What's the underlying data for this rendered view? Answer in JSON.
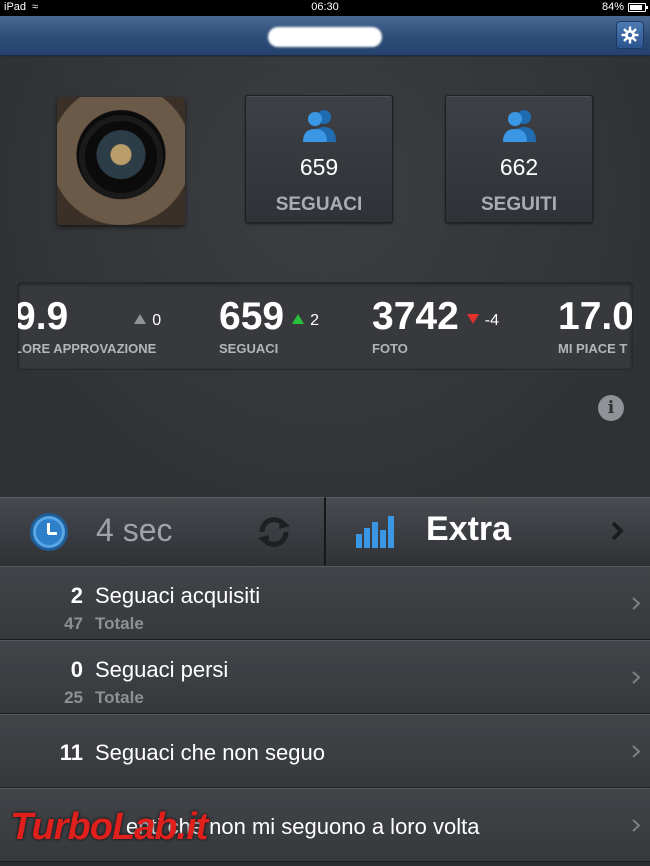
{
  "status_bar": {
    "carrier": "iPad",
    "time": "06:30",
    "battery": "84%"
  },
  "nav": {
    "title": "",
    "settings_icon": "gear-icon"
  },
  "profile": {
    "avatar": "profile-photo"
  },
  "stats": {
    "followers": {
      "value": "659",
      "label": "SEGUACI",
      "icon": "people-icon"
    },
    "following": {
      "value": "662",
      "label": "SEGUITI",
      "icon": "people-icon"
    }
  },
  "ticker": [
    {
      "value": "9.9",
      "caption": "LORE APPROVAZIONE",
      "delta": "0",
      "trend": "flat"
    },
    {
      "value": "659",
      "caption": "SEGUACI",
      "delta": "2",
      "trend": "up"
    },
    {
      "value": "3742",
      "caption": "FOTO",
      "delta": "-4",
      "trend": "down"
    },
    {
      "value": "17.0",
      "caption": "MI PIACE T",
      "delta": "",
      "trend": ""
    }
  ],
  "toolbar": {
    "refresh_interval": "4 sec",
    "extra_label": "Extra"
  },
  "list": [
    {
      "count": "2",
      "title": "Seguaci acquisiti",
      "subcount": "47",
      "sublabel": "Totale"
    },
    {
      "count": "0",
      "title": "Seguaci persi",
      "subcount": "25",
      "sublabel": "Totale"
    },
    {
      "count": "11",
      "title": "Seguaci che non seguo"
    },
    {
      "count": "",
      "title": "enti che non mi seguono a loro volta"
    }
  ],
  "watermark": "TurboLab.it",
  "colors": {
    "nav_blue": "#2d4c78",
    "accent_blue": "#2d7fc9",
    "trend_up": "#27c23a",
    "trend_down": "#e0312c",
    "watermark_red": "#e0201c"
  }
}
